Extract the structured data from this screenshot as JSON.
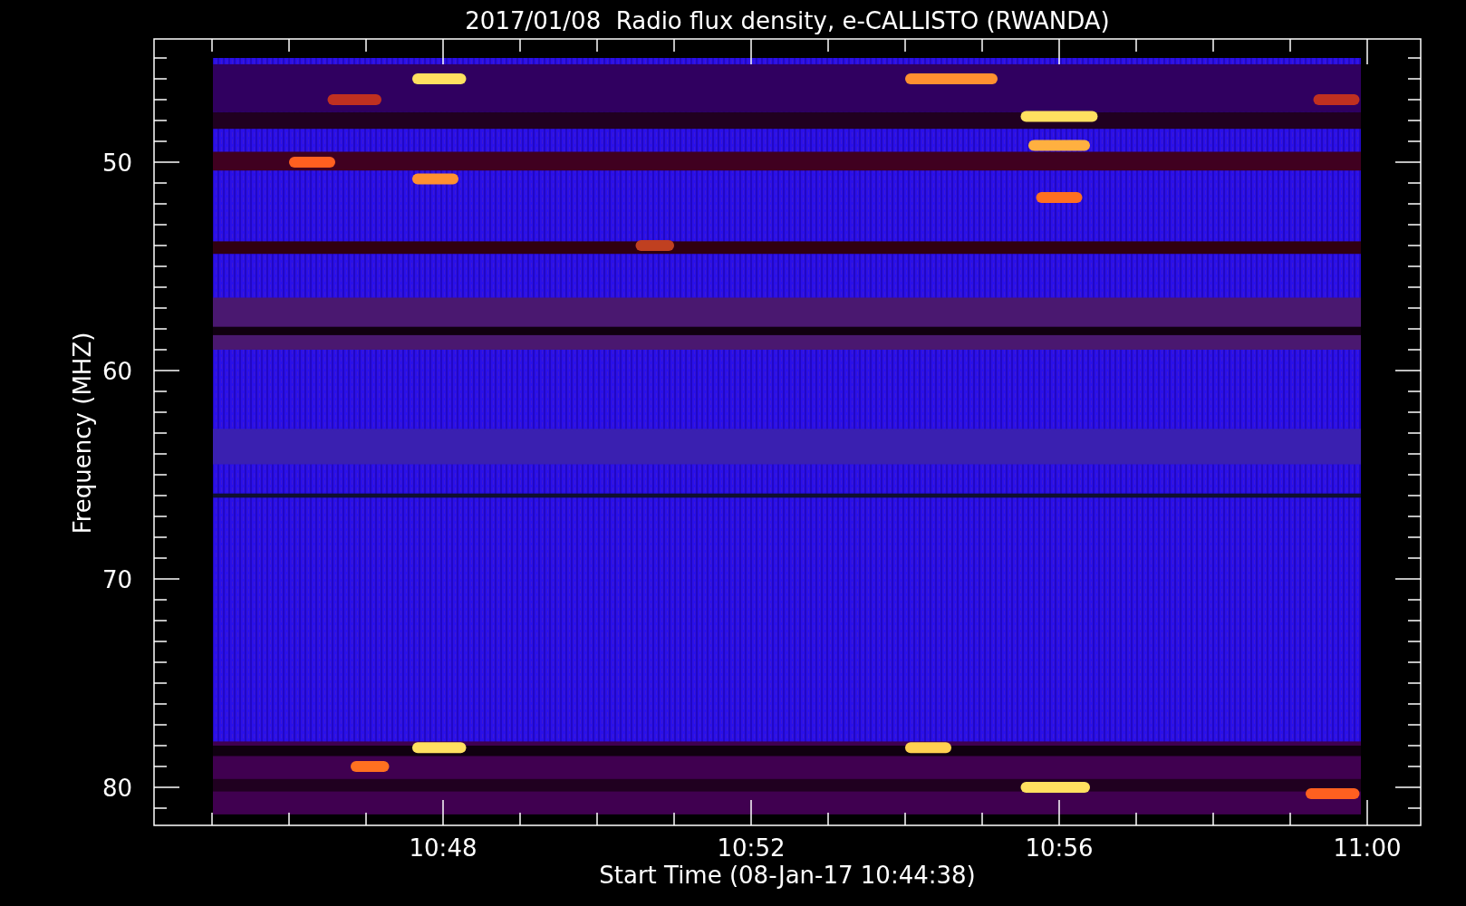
{
  "title": "2017/01/08  Radio flux density, e-CALLISTO (RWANDA)",
  "y_axis": {
    "label": "Frequency (MHZ)",
    "ticks": [
      "50",
      "60",
      "70",
      "80"
    ]
  },
  "x_axis": {
    "label": "Start Time (08-Jan-17 10:44:38)",
    "ticks": [
      "10:48",
      "10:52",
      "10:56",
      "11:00"
    ]
  }
}
